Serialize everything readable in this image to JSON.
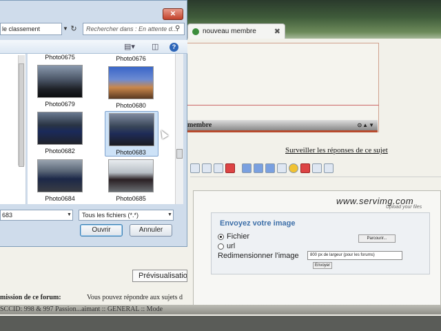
{
  "browser": {
    "tab_title": "nouveau membre",
    "tab_close": "✖"
  },
  "forum": {
    "membre_bar": "membre",
    "membre_arrows": "⊙▲▼",
    "watch_link": "Surveiller les réponses de ce sujet",
    "preview_button": "Prévisualisation",
    "permissions_title": "mission de ce forum:",
    "permissions_text": "Vous pouvez répondre aux sujets d",
    "breadcrumb": "SCCID: 998 & 997 Passion...aimant :: GENERAL :: Mode"
  },
  "upload": {
    "logo": "www.servimg.com",
    "logo_sub": "Upload your files",
    "title": "Envoyez votre image",
    "option_file": "Fichier",
    "option_url": "url",
    "browse_button": "Parcourir...",
    "resize_label": "Redimensionner l'image",
    "resize_value": "800 px de largeur (pour les forums)",
    "send_button": "Envoyer"
  },
  "dialog": {
    "close": "✕",
    "address": "le classement",
    "search_placeholder": "Rechercher dans : En attente d...",
    "filename": "683",
    "filter": "Tous les fichiers (*.*)",
    "open_button": "Ouvrir",
    "cancel_button": "Annuler",
    "help": "?",
    "files": [
      {
        "label": "Photo0675"
      },
      {
        "label": "Photo0676"
      },
      {
        "label": "Photo0679"
      },
      {
        "label": "Photo0680"
      },
      {
        "label": "Photo0682"
      },
      {
        "label": "Photo0683"
      },
      {
        "label": "Photo0684"
      },
      {
        "label": "Photo0685"
      }
    ]
  },
  "colors": {
    "dialog_bg": "#cfdceb",
    "selection": "#cde2f7",
    "upload_title": "#3d6fa8",
    "close_red": "#c2412a"
  }
}
